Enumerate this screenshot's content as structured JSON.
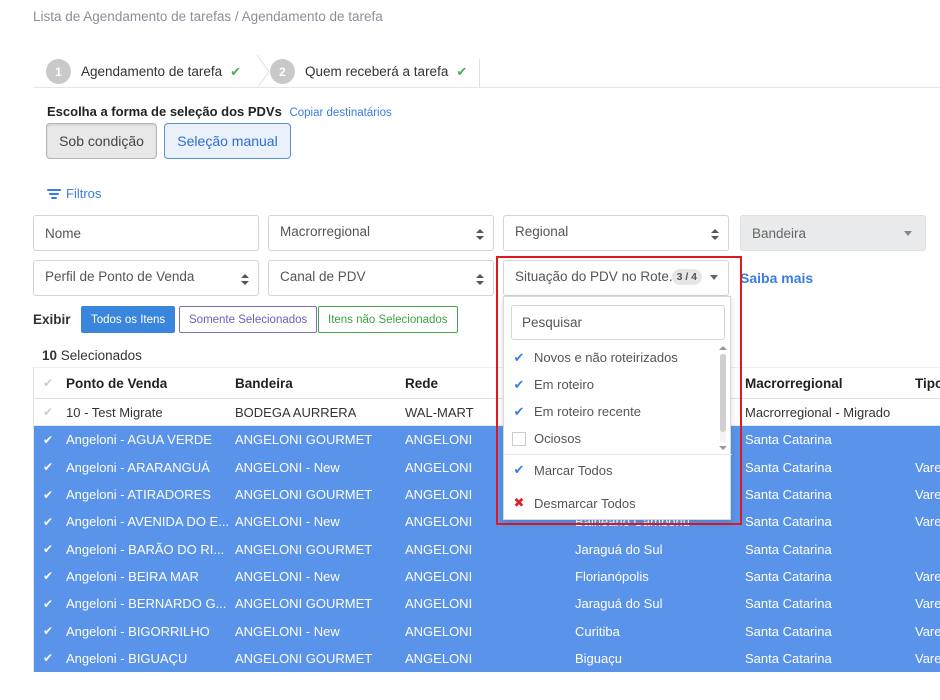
{
  "breadcrumb": "Lista de Agendamento de tarefas / Agendamento de tarefa",
  "steps": [
    {
      "number": "1",
      "label": "Agendamento de tarefa"
    },
    {
      "number": "2",
      "label": "Quem receberá a tarefa"
    }
  ],
  "selection": {
    "title": "Escolha a forma de seleção dos PDVs",
    "copy_link": "Copiar destinatários",
    "btn_condition": "Sob condição",
    "btn_manual": "Seleção manual"
  },
  "filters": {
    "link": "Filtros",
    "nome": "Nome",
    "macrorregional": "Macrorregional",
    "regional": "Regional",
    "bandeira": "Bandeira",
    "perfil": "Perfil de Ponto de Venda",
    "canal": "Canal de PDV",
    "situacao": "Situação do PDV no Rote...",
    "situacao_count": "3 / 4",
    "saiba_mais": "Saiba mais"
  },
  "exibir": {
    "label": "Exibir",
    "all": "Todos os Itens",
    "selected": "Somente Selecionados",
    "not_selected": "Itens não Selecionados"
  },
  "selected_count": {
    "number": "10",
    "label": "Selecionados"
  },
  "table": {
    "headers": [
      "Ponto de Venda",
      "Bandeira",
      "Rede",
      "Macrorregional",
      "Tipo"
    ],
    "rows": [
      {
        "pdv": "10 - Test Migrate",
        "bandeira": "BODEGA AURRERA",
        "rede": "WAL-MART",
        "cidade": "",
        "macro": "Macrorregional - Migrado",
        "tipo": "",
        "selected": false
      },
      {
        "pdv": "Angeloni - AGUA VERDE",
        "bandeira": "ANGELONI GOURMET",
        "rede": "ANGELONI",
        "cidade": "",
        "macro": "Santa Catarina",
        "tipo": "",
        "selected": true
      },
      {
        "pdv": "Angeloni - ARARANGUÁ",
        "bandeira": "ANGELONI - New",
        "rede": "ANGELONI",
        "cidade": "",
        "macro": "Santa Catarina",
        "tipo": "Vare",
        "selected": true
      },
      {
        "pdv": "Angeloni - ATIRADORES",
        "bandeira": "ANGELONI GOURMET",
        "rede": "ANGELONI",
        "cidade": "",
        "macro": "Santa Catarina",
        "tipo": "Vare",
        "selected": true
      },
      {
        "pdv": "Angeloni - AVENIDA DO E...",
        "bandeira": "ANGELONI - New",
        "rede": "ANGELONI",
        "cidade": "Balneário Camboriú",
        "macro": "Santa Catarina",
        "tipo": "Vare",
        "selected": true
      },
      {
        "pdv": "Angeloni - BARÃO DO RI...",
        "bandeira": "ANGELONI GOURMET",
        "rede": "ANGELONI",
        "cidade": "Jaraguá do Sul",
        "macro": "Santa Catarina",
        "tipo": "",
        "selected": true
      },
      {
        "pdv": "Angeloni - BEIRA MAR",
        "bandeira": "ANGELONI - New",
        "rede": "ANGELONI",
        "cidade": "Florianópolis",
        "macro": "Santa Catarina",
        "tipo": "Vare",
        "selected": true
      },
      {
        "pdv": "Angeloni - BERNARDO G...",
        "bandeira": "ANGELONI GOURMET",
        "rede": "ANGELONI",
        "cidade": "Jaraguá do Sul",
        "macro": "Santa Catarina",
        "tipo": "Vare",
        "selected": true
      },
      {
        "pdv": "Angeloni - BIGORRILHO",
        "bandeira": "ANGELONI - New",
        "rede": "ANGELONI",
        "cidade": "Curitiba",
        "macro": "Santa Catarina",
        "tipo": "Vare",
        "selected": true
      },
      {
        "pdv": "Angeloni - BIGUAÇU",
        "bandeira": "ANGELONI GOURMET",
        "rede": "ANGELONI",
        "cidade": "Biguaçu",
        "macro": "Santa Catarina",
        "tipo": "Vare",
        "selected": true
      }
    ]
  },
  "dropdown": {
    "search_placeholder": "Pesquisar",
    "options": [
      {
        "label": "Novos e não roteirizados",
        "checked": true
      },
      {
        "label": "Em roteiro",
        "checked": true
      },
      {
        "label": "Em roteiro recente",
        "checked": true
      },
      {
        "label": "Ociosos",
        "checked": false
      }
    ],
    "select_all": "Marcar Todos",
    "deselect_all": "Desmarcar Todos"
  },
  "colors": {
    "accent": "#3b7ddd",
    "selected_row": "#5a93ea",
    "highlight": "#e0191f",
    "success": "#4caf50"
  }
}
